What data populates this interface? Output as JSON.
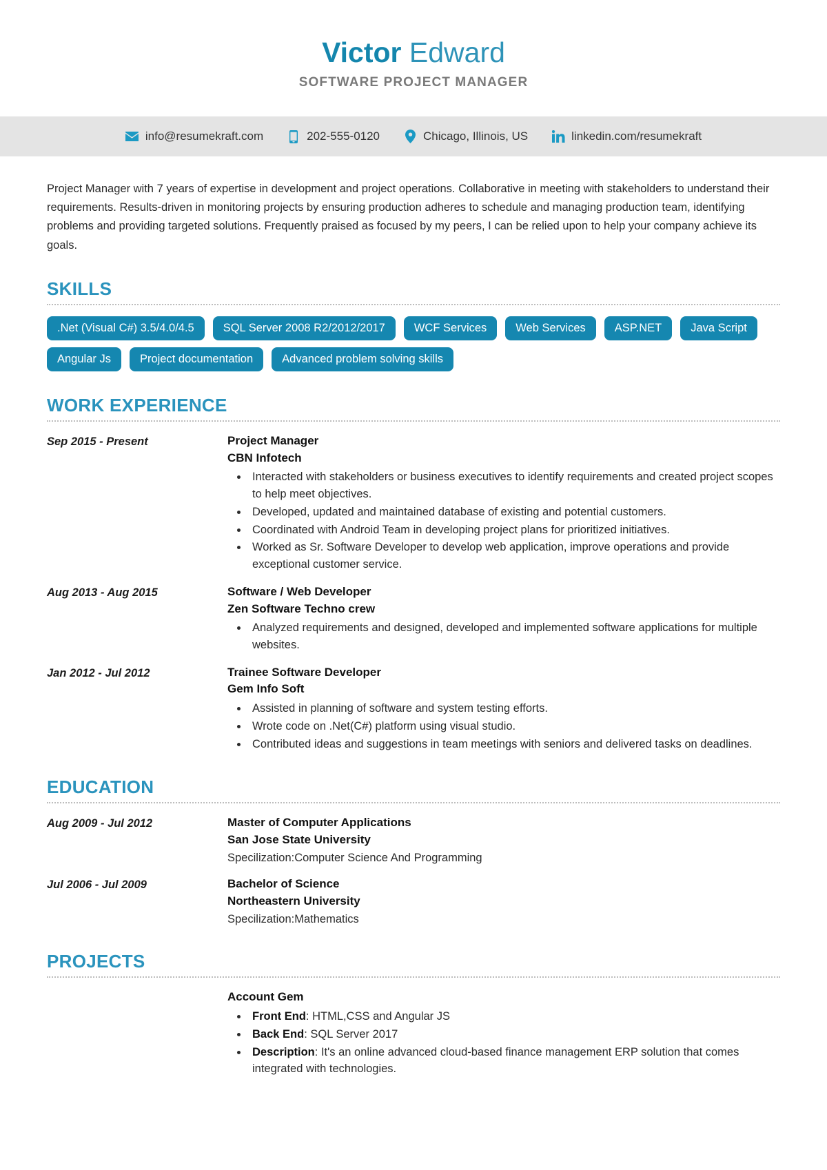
{
  "header": {
    "first_name": "Victor",
    "last_name": " Edward",
    "job_title": "SOFTWARE PROJECT MANAGER",
    "accent_color": "#1587b0",
    "title_color": "#7a7a7a"
  },
  "contact": {
    "email": "info@resumekraft.com",
    "email_icon": "envelope-icon",
    "phone": "202-555-0120",
    "phone_icon": "mobile-phone-icon",
    "location": "Chicago, Illinois, US",
    "location_icon": "map-pin-icon",
    "linkedin": "linkedin.com/resumekraft",
    "linkedin_icon": "linkedin-icon",
    "bar_color": "#e4e4e4"
  },
  "summary": "Project Manager with 7 years of expertise in development and project operations. Collaborative in meeting with stakeholders to understand their requirements. Results-driven in monitoring projects by ensuring production adheres to schedule and managing production team, identifying problems and providing targeted solutions. Frequently praised as focused by my peers, I can be relied upon to help your company achieve its goals.",
  "sections": {
    "skills_title": "SKILLS",
    "work_title": "WORK EXPERIENCE",
    "education_title": "EDUCATION",
    "projects_title": "PROJECTS"
  },
  "skills": [
    ".Net (Visual C#) 3.5/4.0/4.5",
    "SQL Server 2008 R2/2012/2017",
    "WCF Services",
    "Web Services",
    "ASP.NET",
    "Java Script",
    "Angular Js",
    "Project documentation",
    "Advanced problem solving skills"
  ],
  "work_experience": [
    {
      "date": "Sep 2015 - Present",
      "role": "Project Manager",
      "org": "CBN Infotech",
      "bullets": [
        "Interacted with stakeholders or business executives to identify requirements and created project scopes to help meet objectives.",
        "Developed, updated and maintained database of existing and potential customers.",
        "Coordinated with Android Team in developing project plans for prioritized initiatives.",
        "Worked as Sr. Software Developer to develop web application, improve operations and provide exceptional customer service."
      ]
    },
    {
      "date": "Aug 2013 - Aug 2015",
      "role": "Software / Web Developer",
      "org": "Zen Software Techno crew",
      "bullets": [
        "Analyzed requirements and designed, developed and implemented software applications for multiple websites."
      ]
    },
    {
      "date": "Jan 2012 - Jul 2012",
      "role": "Trainee Software Developer",
      "org": "Gem Info Soft",
      "bullets": [
        "Assisted in planning of software and system testing efforts.",
        "Wrote code on .Net(C#) platform using visual studio.",
        "Contributed ideas and suggestions in team meetings with seniors and delivered tasks on deadlines."
      ]
    }
  ],
  "education": [
    {
      "date": "Aug 2009 - Jul 2012",
      "degree": "Master of Computer Applications",
      "school": "San Jose State University",
      "specialization": "Specilization:Computer Science And Programming"
    },
    {
      "date": "Jul 2006 - Jul 2009",
      "degree": "Bachelor of Science",
      "school": "Northeastern University",
      "specialization": "Specilization:Mathematics"
    }
  ],
  "projects": [
    {
      "name": "Account Gem",
      "items": [
        {
          "label": "Front End",
          "value": ": HTML,CSS and Angular JS"
        },
        {
          "label": "Back End",
          "value": ": SQL Server 2017"
        },
        {
          "label": "Description",
          "value": ": It's an online advanced cloud-based finance management ERP solution that comes integrated with technologies."
        }
      ]
    }
  ]
}
